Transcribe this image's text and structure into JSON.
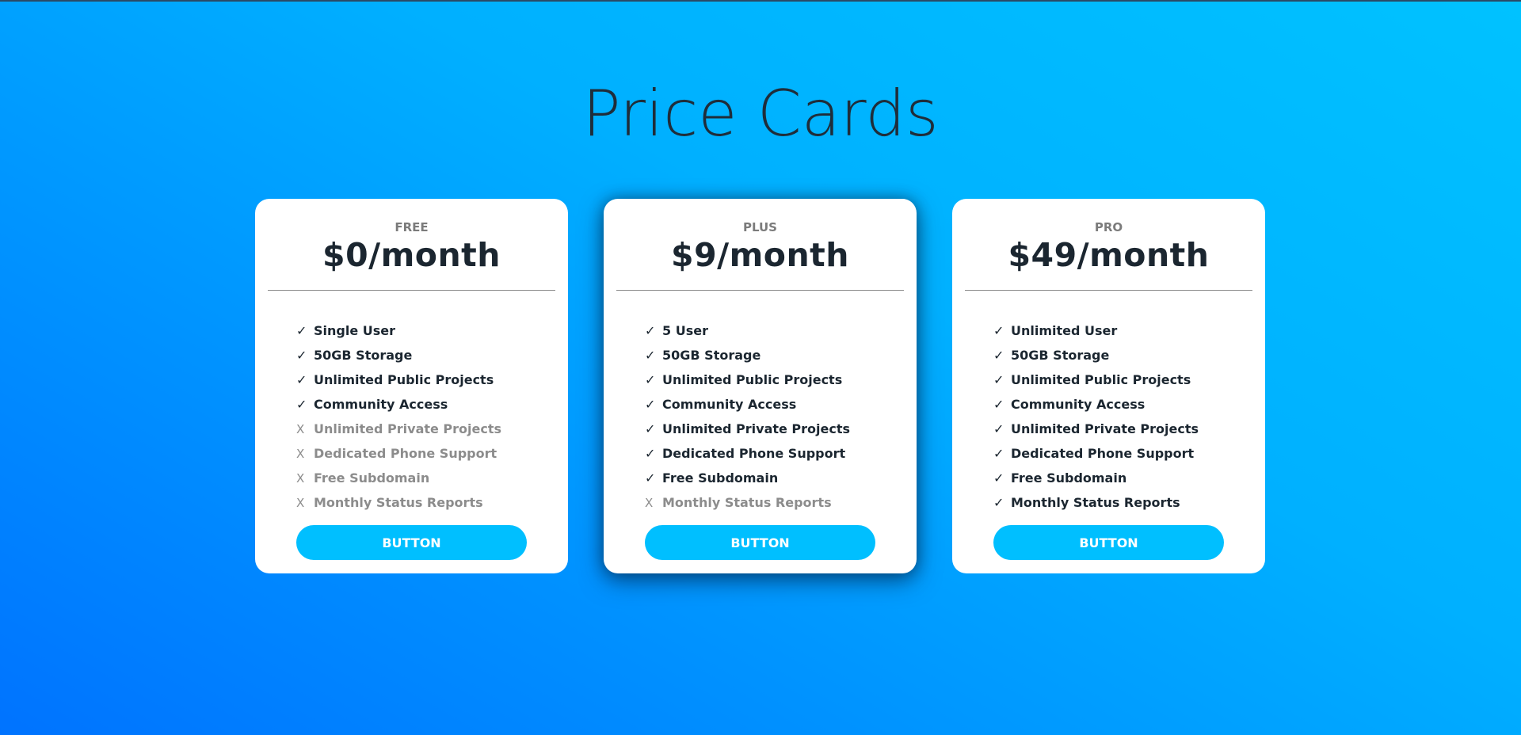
{
  "page": {
    "title": "Price Cards"
  },
  "cards": [
    {
      "plan": "FREE",
      "price": "$0/month",
      "button_label": "BUTTON",
      "features": [
        {
          "label": "Single User",
          "included": true
        },
        {
          "label": "50GB Storage",
          "included": true
        },
        {
          "label": "Unlimited Public Projects",
          "included": true
        },
        {
          "label": "Community Access",
          "included": true
        },
        {
          "label": "Unlimited Private Projects",
          "included": false
        },
        {
          "label": "Dedicated Phone Support",
          "included": false
        },
        {
          "label": "Free Subdomain",
          "included": false
        },
        {
          "label": "Monthly Status Reports",
          "included": false
        }
      ]
    },
    {
      "plan": "PLUS",
      "price": "$9/month",
      "button_label": "BUTTON",
      "featured": true,
      "features": [
        {
          "label": "5 User",
          "included": true
        },
        {
          "label": "50GB Storage",
          "included": true
        },
        {
          "label": "Unlimited Public Projects",
          "included": true
        },
        {
          "label": "Community Access",
          "included": true
        },
        {
          "label": "Unlimited Private Projects",
          "included": true
        },
        {
          "label": "Dedicated Phone Support",
          "included": true
        },
        {
          "label": "Free Subdomain",
          "included": true
        },
        {
          "label": "Monthly Status Reports",
          "included": false
        }
      ]
    },
    {
      "plan": "PRO",
      "price": "$49/month",
      "button_label": "BUTTON",
      "features": [
        {
          "label": "Unlimited User",
          "included": true
        },
        {
          "label": "50GB Storage",
          "included": true
        },
        {
          "label": "Unlimited Public Projects",
          "included": true
        },
        {
          "label": "Community Access",
          "included": true
        },
        {
          "label": "Unlimited Private Projects",
          "included": true
        },
        {
          "label": "Dedicated Phone Support",
          "included": true
        },
        {
          "label": "Free Subdomain",
          "included": true
        },
        {
          "label": "Monthly Status Reports",
          "included": true
        }
      ]
    }
  ],
  "marks": {
    "included": "✓",
    "excluded": "X"
  },
  "colors": {
    "background_start": "#00c2ff",
    "background_end": "#0073ff",
    "button": "#00bfff",
    "text_dark": "#1b2630",
    "text_muted": "#8c8c8c"
  }
}
